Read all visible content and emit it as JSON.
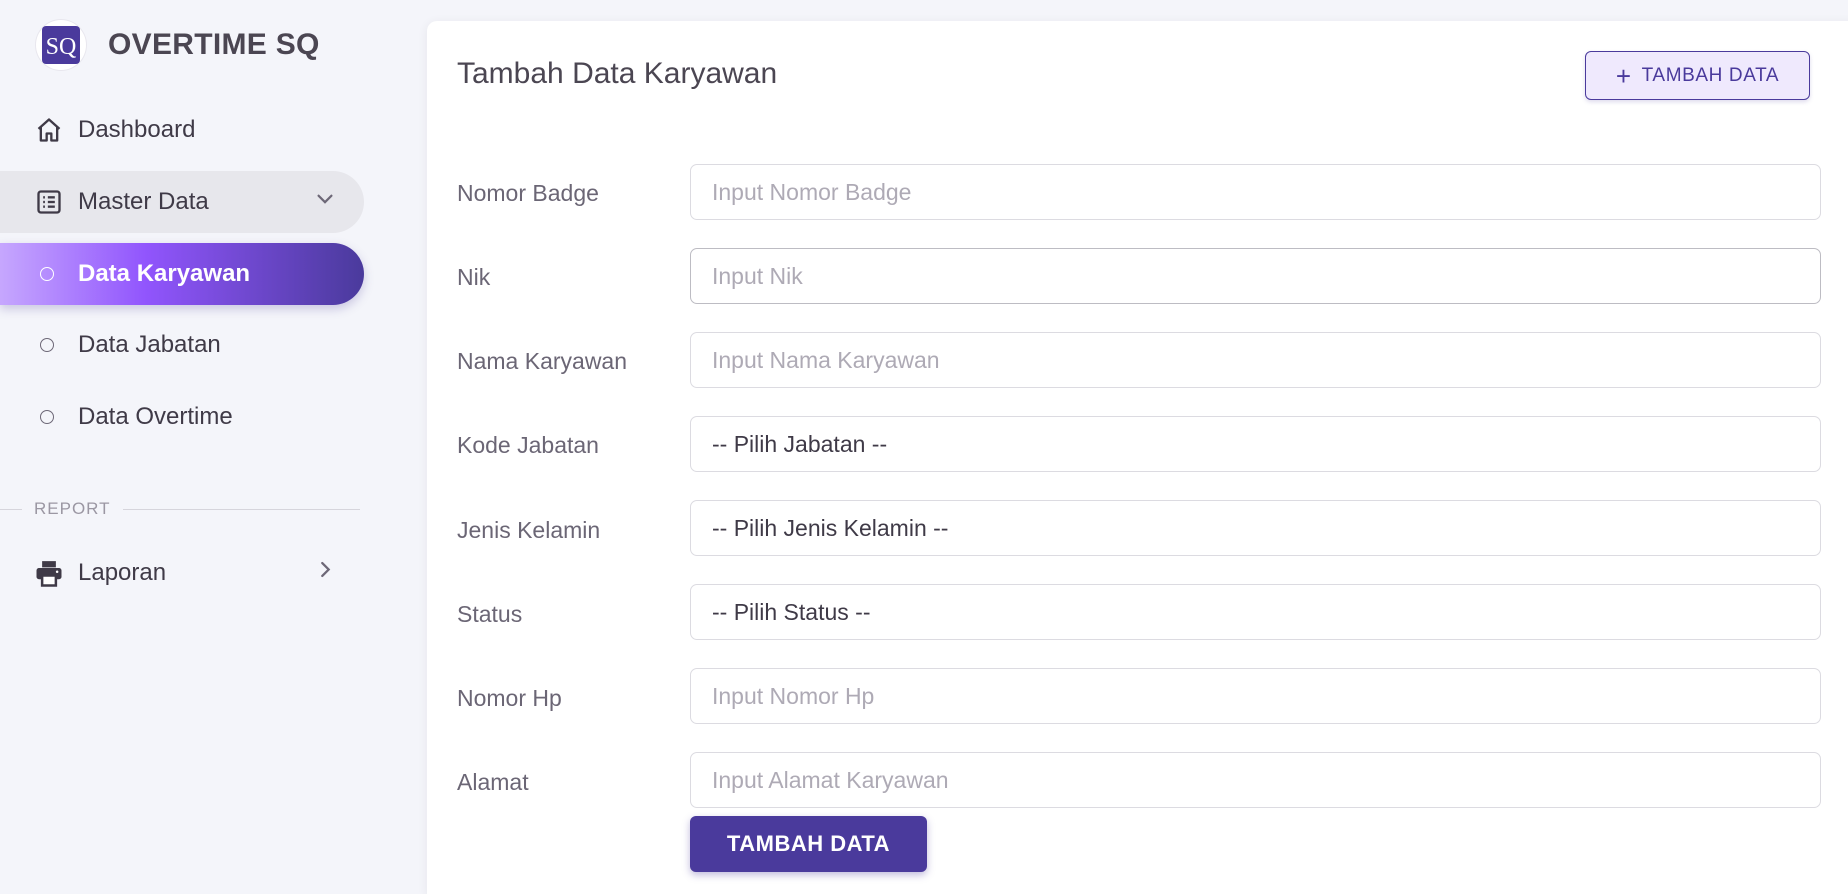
{
  "brand": {
    "title": "OVERTIME SQ",
    "logo_text": "SQ"
  },
  "sidebar": {
    "items": [
      {
        "label": "Dashboard",
        "icon": "home-icon"
      },
      {
        "label": "Master Data",
        "icon": "list-icon"
      },
      {
        "label": "Data Karyawan"
      },
      {
        "label": "Data Jabatan"
      },
      {
        "label": "Data Overtime"
      },
      {
        "label": "Laporan",
        "icon": "printer-icon"
      }
    ],
    "section_report": "REPORT",
    "active_item": "Data Karyawan"
  },
  "page": {
    "title": "Tambah Data Karyawan",
    "header_button": "TAMBAH DATA",
    "submit_button": "TAMBAH DATA"
  },
  "form": {
    "fields": [
      {
        "label": "Nomor Badge",
        "placeholder": "Input Nomor Badge",
        "type": "input"
      },
      {
        "label": "Nik",
        "placeholder": "Input Nik",
        "type": "input"
      },
      {
        "label": "Nama Karyawan",
        "placeholder": "Input Nama Karyawan",
        "type": "input"
      },
      {
        "label": "Kode Jabatan",
        "value": "-- Pilih Jabatan --",
        "type": "select"
      },
      {
        "label": "Jenis Kelamin",
        "value": "-- Pilih Jenis Kelamin --",
        "type": "select"
      },
      {
        "label": "Status",
        "value": "-- Pilih Status --",
        "type": "select"
      },
      {
        "label": "Nomor Hp",
        "placeholder": "Input Nomor Hp",
        "type": "input"
      },
      {
        "label": "Alamat",
        "placeholder": "Input Alamat Karyawan",
        "type": "input"
      }
    ]
  },
  "colors": {
    "primary": "#4a3a9c",
    "accent": "#9155fd",
    "background": "#f4f5fa"
  }
}
